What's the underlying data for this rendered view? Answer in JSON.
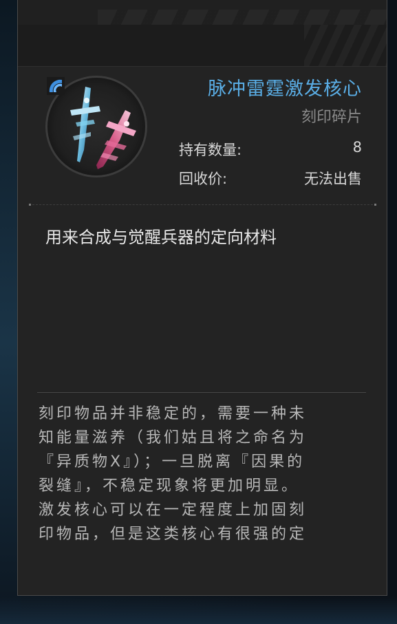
{
  "item": {
    "name": "脉冲雷霆激发核心",
    "type": "刻印碎片",
    "icon": "dual-swords-icon",
    "accent_color": "#5aaee6",
    "stats": [
      {
        "label": "持有数量:",
        "value": "8"
      },
      {
        "label": "回收价:",
        "value": "无法出售"
      }
    ]
  },
  "description": "用来合成与觉醒兵器的定向材料",
  "lore": {
    "lines": [
      "刻印物品并非稳定的，需要一种未",
      "知能量滋养（我们姑且将之命名为",
      "『异质物X』）；一旦脱离『因果的",
      "裂缝』，不稳定现象将更加明显。",
      "激发核心可以在一定程度上加固刻",
      "印物品，但是这类核心有很强的定"
    ]
  }
}
